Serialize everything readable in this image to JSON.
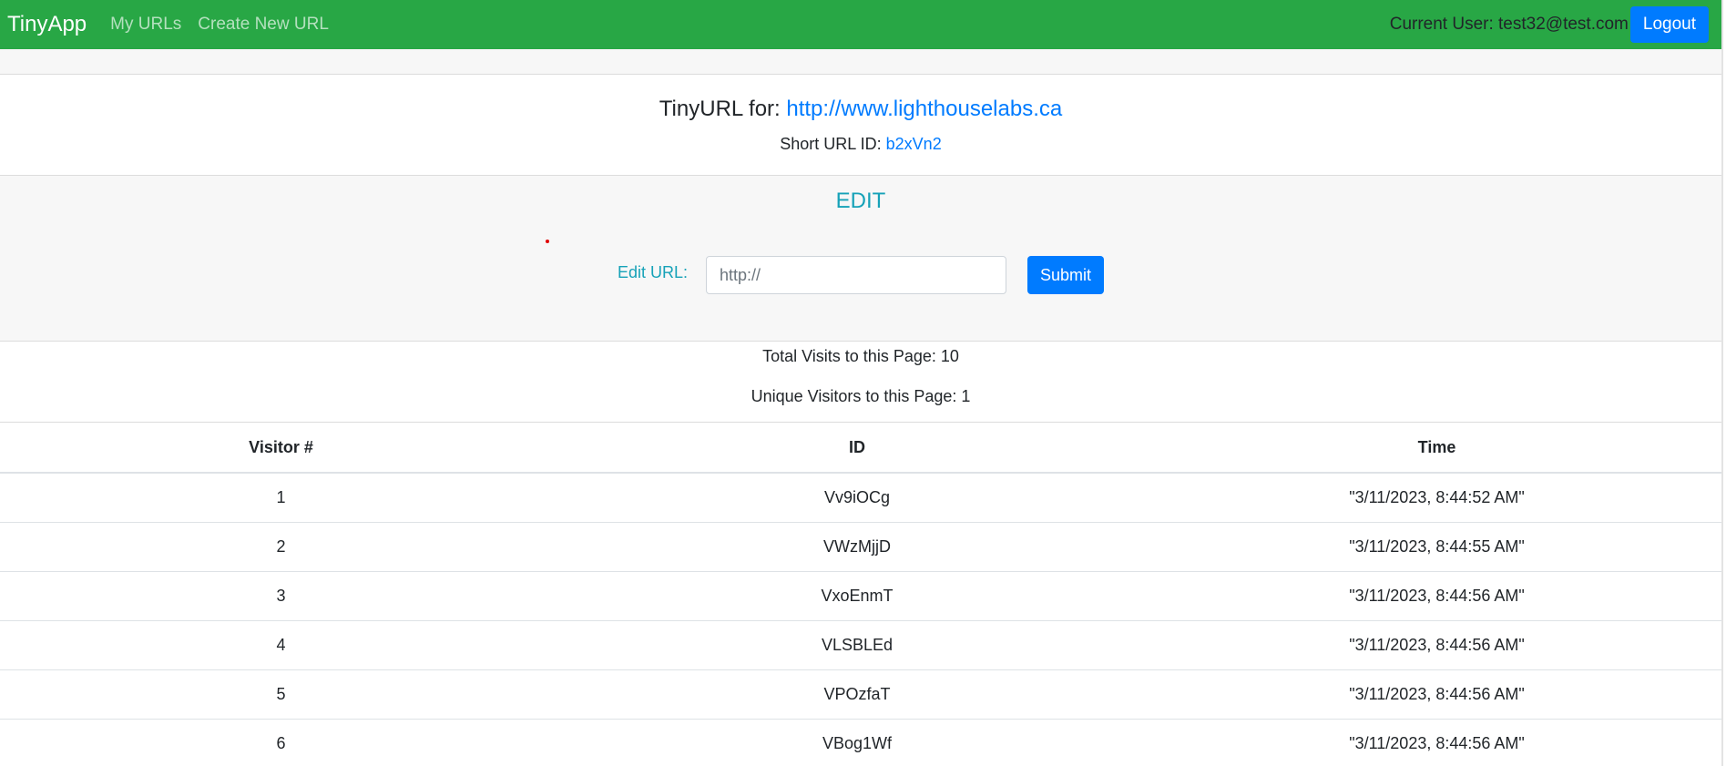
{
  "navbar": {
    "brand": "TinyApp",
    "links": [
      "My URLs",
      "Create New URL"
    ],
    "current_user": "Current User: test32@test.com",
    "logout_label": "Logout"
  },
  "url_info": {
    "title_prefix": "TinyURL for: ",
    "long_url": "http://www.lighthouselabs.ca",
    "short_id_prefix": "Short URL ID: ",
    "short_id": "b2xVn2"
  },
  "edit": {
    "heading": "EDIT",
    "label": "Edit URL:",
    "placeholder": "http://",
    "submit_label": "Submit"
  },
  "stats": {
    "total_visits": "Total Visits to this Page: 10",
    "unique_visitors": "Unique Visitors to this Page: 1"
  },
  "table": {
    "headers": [
      "Visitor #",
      "ID",
      "Time"
    ],
    "rows": [
      [
        "1",
        "Vv9iOCg",
        "\"3/11/2023, 8:44:52 AM\""
      ],
      [
        "2",
        "VWzMjjD",
        "\"3/11/2023, 8:44:55 AM\""
      ],
      [
        "3",
        "VxoEnmT",
        "\"3/11/2023, 8:44:56 AM\""
      ],
      [
        "4",
        "VLSBLEd",
        "\"3/11/2023, 8:44:56 AM\""
      ],
      [
        "5",
        "VPOzfaT",
        "\"3/11/2023, 8:44:56 AM\""
      ],
      [
        "6",
        "VBog1Wf",
        "\"3/11/2023, 8:44:56 AM\""
      ]
    ]
  },
  "colors": {
    "navbar_bg": "#28a745",
    "primary": "#007bff",
    "info": "#17a2b8",
    "panel_bg": "#f7f7f7"
  }
}
